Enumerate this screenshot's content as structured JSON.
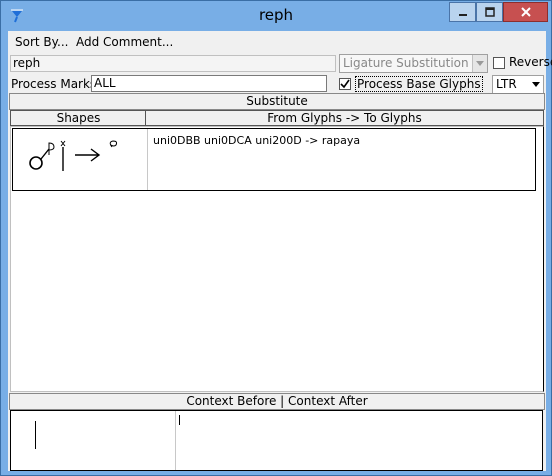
{
  "window": {
    "title": "reph"
  },
  "menu": {
    "sort_by": "Sort By...",
    "add_comment": "Add Comment..."
  },
  "form": {
    "lookup_name": "reph",
    "process_marks_label": "Process Marks:",
    "process_marks_value": "ALL",
    "lookup_type": "Ligature Substitution",
    "reverse_label": "Reverse",
    "reverse_checked": false,
    "process_base_glyphs_label": "Process Base Glyphs",
    "process_base_glyphs_checked": true,
    "direction": "LTR"
  },
  "substitute": {
    "section_label": "Substitute",
    "columns": {
      "shapes": "Shapes",
      "glyphs": "From Glyphs -> To Glyphs"
    },
    "rows": [
      {
        "rule": "uni0DBB uni0DCA uni200D -> rapaya"
      }
    ]
  },
  "context": {
    "section_label": "Context Before | Context After"
  },
  "colors": {
    "titlebar": "#78aee6",
    "close_button": "#c75050",
    "client_bg": "#f0f0f0"
  }
}
